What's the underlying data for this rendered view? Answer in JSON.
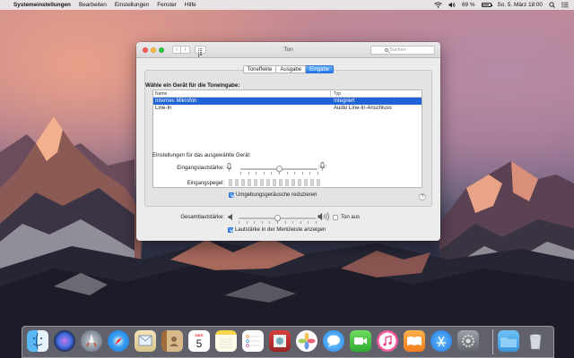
{
  "menubar": {
    "apple": "",
    "items": [
      "Systemeinstellungen",
      "Bearbeiten",
      "Einstellungen",
      "Fenster",
      "Hilfe"
    ],
    "battery": "69 %",
    "datetime": "So. 5. März  18:00"
  },
  "window": {
    "title": "Ton",
    "search_placeholder": "Suchen",
    "tabs": [
      {
        "label": "Toneffekte",
        "active": false
      },
      {
        "label": "Ausgabe",
        "active": false
      },
      {
        "label": "Eingabe",
        "active": true
      }
    ],
    "section_title": "Wähle ein Gerät für die Toneingabe:",
    "table": {
      "headers": [
        "Name",
        "Typ"
      ],
      "rows": [
        {
          "name": "Internes Mikrofon",
          "type": "Integriert",
          "selected": true
        },
        {
          "name": "Line-In",
          "type": "Audio Line-In-Anschluss",
          "selected": false
        }
      ]
    },
    "device_settings_label": "Einstellungen für das ausgewählte Gerät:",
    "input_volume_label": "Eingangslautstärke:",
    "input_volume_level": 0.5,
    "input_level_label": "Eingangspegel:",
    "input_level_segments": 15,
    "noise_reduction_label": "Umgebungsgeräusche reduzieren",
    "noise_reduction_checked": true,
    "help": "?",
    "output_volume_label": "Gesamtlautstärke:",
    "output_volume_level": 0.5,
    "mute_label": "Ton aus",
    "mute_checked": false,
    "show_in_menubar_label": "Lautstärke in der Menüleiste anzeigen",
    "show_in_menubar_checked": true
  },
  "dock": {
    "apps": [
      "finder-icon",
      "siri-icon",
      "launchpad-icon",
      "safari-icon",
      "mail-icon",
      "contacts-icon",
      "calendar-icon",
      "notes-icon",
      "reminders-icon",
      "photo-booth-icon",
      "photos-icon",
      "messages-icon",
      "facetime-icon",
      "itunes-icon",
      "ibooks-icon",
      "app-store-icon",
      "system-preferences-icon",
      "downloads-folder-icon",
      "trash-icon"
    ],
    "calendar_day": "5",
    "calendar_month": "MÄR"
  }
}
